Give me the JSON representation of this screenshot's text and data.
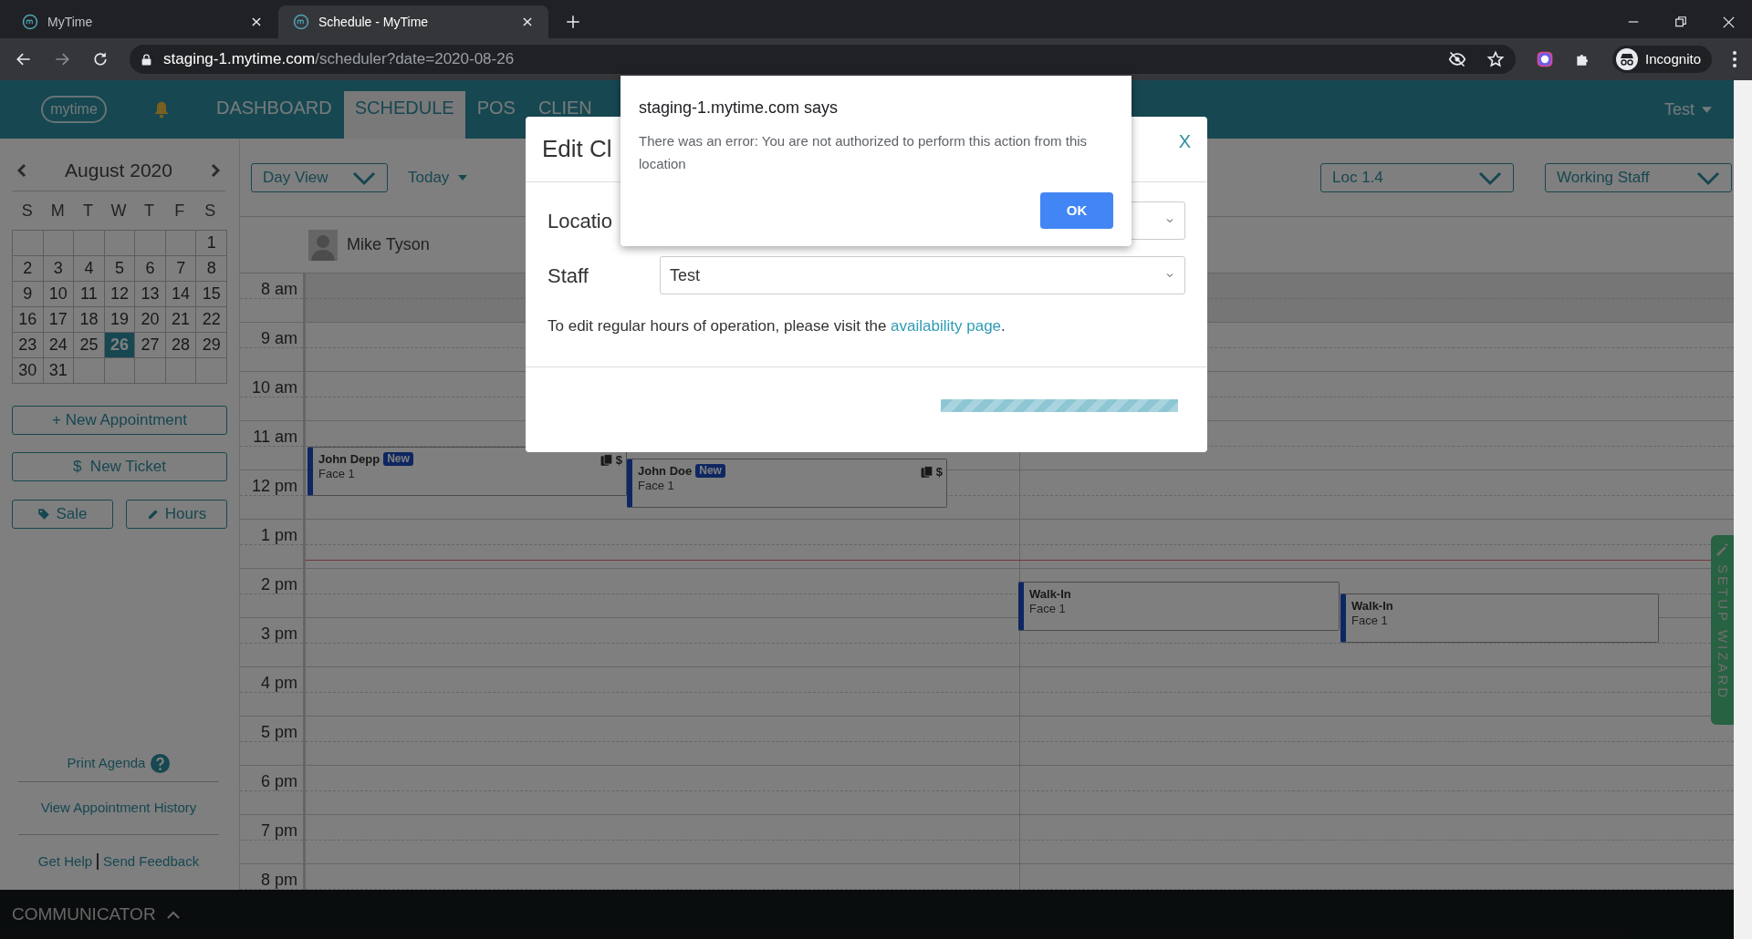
{
  "browser": {
    "tabs": [
      {
        "title": "MyTime",
        "selected": false
      },
      {
        "title": "Schedule - MyTime",
        "selected": true
      }
    ],
    "url": {
      "host": "staging-1.mytime.com",
      "path": "/scheduler?date=2020-08-26"
    },
    "profile": "Incognito"
  },
  "header": {
    "logo": "mytime",
    "nav": [
      {
        "label": "DASHBOARD",
        "selected": false
      },
      {
        "label": "SCHEDULE",
        "selected": true
      },
      {
        "label": "POS",
        "selected": false
      },
      {
        "label": "CLIEN",
        "selected": false
      }
    ],
    "user": "Test"
  },
  "sidebar": {
    "month": "August 2020",
    "weekdays": [
      "S",
      "M",
      "T",
      "W",
      "T",
      "F",
      "S"
    ],
    "weeks": [
      [
        {
          "kind": "blank"
        },
        {
          "kind": "blank"
        },
        {
          "kind": "blank"
        },
        {
          "kind": "blank"
        },
        {
          "kind": "blank"
        },
        {
          "kind": "blank"
        },
        {
          "kind": "day",
          "label": "1",
          "selected": false
        }
      ],
      [
        {
          "kind": "day",
          "label": "2",
          "selected": false
        },
        {
          "kind": "day",
          "label": "3",
          "selected": false
        },
        {
          "kind": "day",
          "label": "4",
          "selected": false
        },
        {
          "kind": "day",
          "label": "5",
          "selected": false
        },
        {
          "kind": "day",
          "label": "6",
          "selected": false
        },
        {
          "kind": "day",
          "label": "7",
          "selected": false
        },
        {
          "kind": "day",
          "label": "8",
          "selected": false
        }
      ],
      [
        {
          "kind": "day",
          "label": "9",
          "selected": false
        },
        {
          "kind": "day",
          "label": "10",
          "selected": false
        },
        {
          "kind": "day",
          "label": "11",
          "selected": false
        },
        {
          "kind": "day",
          "label": "12",
          "selected": false
        },
        {
          "kind": "day",
          "label": "13",
          "selected": false
        },
        {
          "kind": "day",
          "label": "14",
          "selected": false
        },
        {
          "kind": "day",
          "label": "15",
          "selected": false
        }
      ],
      [
        {
          "kind": "day",
          "label": "16",
          "selected": false
        },
        {
          "kind": "day",
          "label": "17",
          "selected": false
        },
        {
          "kind": "day",
          "label": "18",
          "selected": false
        },
        {
          "kind": "day",
          "label": "19",
          "selected": false
        },
        {
          "kind": "day",
          "label": "20",
          "selected": false
        },
        {
          "kind": "day",
          "label": "21",
          "selected": false
        },
        {
          "kind": "day",
          "label": "22",
          "selected": false
        }
      ],
      [
        {
          "kind": "day",
          "label": "23",
          "selected": false
        },
        {
          "kind": "day",
          "label": "24",
          "selected": false
        },
        {
          "kind": "day",
          "label": "25",
          "selected": false
        },
        {
          "kind": "day",
          "label": "26",
          "selected": true
        },
        {
          "kind": "day",
          "label": "27",
          "selected": false
        },
        {
          "kind": "day",
          "label": "28",
          "selected": false
        },
        {
          "kind": "day",
          "label": "29",
          "selected": false
        }
      ],
      [
        {
          "kind": "day",
          "label": "30",
          "selected": false
        },
        {
          "kind": "day",
          "label": "31",
          "selected": false
        },
        {
          "kind": "blank"
        },
        {
          "kind": "blank"
        },
        {
          "kind": "blank"
        },
        {
          "kind": "blank"
        },
        {
          "kind": "blank"
        }
      ]
    ],
    "new_appointment": "+ New Appointment",
    "new_ticket": "$  New Ticket",
    "sale": "Sale",
    "hours": "Hours",
    "print_agenda": "Print Agenda",
    "history": "View Appointment History",
    "help_links": [
      "Get Help",
      "Send Feedback"
    ]
  },
  "toolbar": {
    "view": "Day View",
    "today": "Today",
    "location": "Loc 1.4",
    "staff_filter": "Working Staff"
  },
  "staff": "Mike Tyson",
  "times": [
    "8 am",
    "9 am",
    "10 am",
    "11 am",
    "12 pm",
    "1 pm",
    "2 pm",
    "3 pm",
    "4 pm",
    "5 pm",
    "6 pm",
    "7 pm",
    "8 pm"
  ],
  "appointments": [
    {
      "client": "John Depp",
      "badge": "New",
      "service": "Face 1",
      "card_icon": true,
      "tag": "$"
    },
    {
      "client": "John Doe",
      "badge": "New",
      "service": "Face 1",
      "card_icon": true,
      "tag": "$"
    },
    {
      "client": "Walk-In",
      "service": "Face 1",
      "card_icon": false
    },
    {
      "client": "Walk-In",
      "service": "Face 1",
      "card_icon": false
    }
  ],
  "setup_wizard": "SETUP WIZARD",
  "communicator": "COMMUNICATOR",
  "modal": {
    "title": "Edit Cl",
    "close": "X",
    "progress": {
      "level": 1
    },
    "location_label": "Locatio",
    "staff_label": "Staff",
    "staff_value": "Test",
    "note": "To edit regular hours of operation, please visit the",
    "link": "availability page",
    "note_end": "."
  },
  "alert": {
    "title": "staging-1.mytime.com says",
    "message": "There was an error: You are not authorized to perform this action from this location",
    "button": "OK"
  }
}
